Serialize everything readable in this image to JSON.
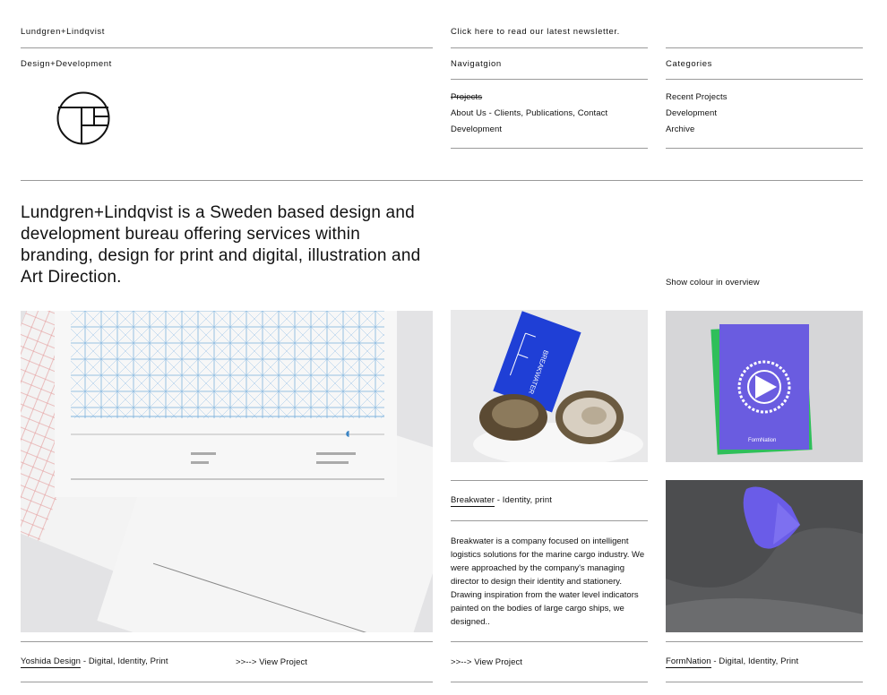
{
  "header": {
    "brand": "Lundgren+Lindqvist",
    "newsletter": "Click here to read our latest newsletter.",
    "tagline": "Design+Development"
  },
  "navigation": {
    "title": "Navigatgion",
    "items": [
      {
        "label": "Projects",
        "struck": true
      },
      {
        "label": "About Us - Clients, Publications, Contact"
      },
      {
        "label": "Development"
      }
    ]
  },
  "categories": {
    "title": "Categories",
    "items": [
      {
        "label": "Recent Projects"
      },
      {
        "label": "Development"
      },
      {
        "label": "Archive"
      }
    ]
  },
  "intro": "Lundgren+Lindqvist is a Sweden based design and development bureau offering services within branding, design for print and digital, illustration and Art Direction.",
  "show_colour": "Show colour in overview",
  "projects": {
    "yoshida": {
      "name": "Yoshida Design",
      "tags": " - Digital, Identity, Print",
      "view": ">>--> View Project"
    },
    "breakwater": {
      "name": "Breakwater",
      "tags": " - Identity, print",
      "description": "Breakwater is a company focused on intelligent logistics solutions for the marine cargo industry. We were approached by the company's managing director to design their identity and stationery. Drawing inspiration from the water level indicators painted on the bodies of large cargo ships, we designed..",
      "view": ">>--> View Project",
      "card_text": "BREAKWATER"
    },
    "formnation": {
      "name": "FormNation",
      "tags": " - Digital, Identity, Print",
      "card_text": "FormNation"
    }
  },
  "colors": {
    "rule": "#9a9a9a",
    "breakwater_blue": "#1f3fd6",
    "formnation_purple": "#6a5ce0",
    "formnation_green": "#2fbf5a"
  }
}
